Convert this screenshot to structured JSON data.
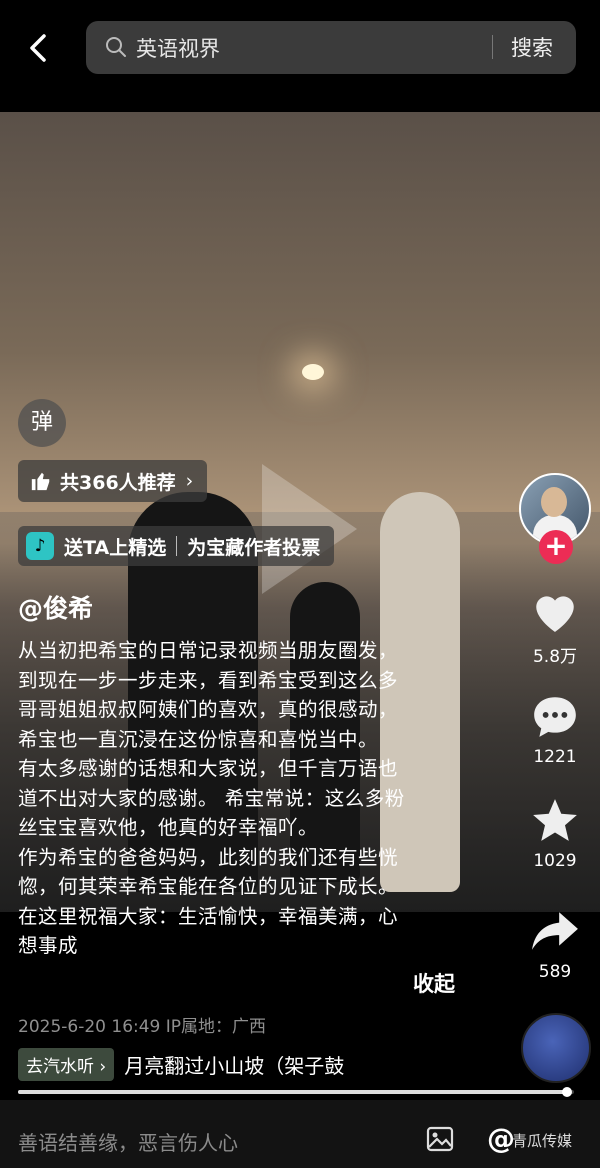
{
  "search": {
    "query": "英语视界",
    "button": "搜索"
  },
  "danmu": "弹",
  "recommend": {
    "label": "共366人推荐",
    "chevron": "›"
  },
  "featured": {
    "left": "送TA上精选",
    "right": "为宝藏作者投票",
    "logo": "♪"
  },
  "author": "@俊希",
  "description": [
    "从当初把希宝的日常记录视频当朋友圈发，",
    "到现在一步一步走来，看到希宝受到这么多",
    "哥哥姐姐叔叔阿姨们的喜欢，真的很感动，",
    "希宝也一直沉浸在这份惊喜和喜悦当中。",
    "有太多感谢的话想和大家说，但千言万语也",
    "道不出对大家的感谢。 希宝常说：这么多粉",
    "丝宝宝喜欢他，他真的好幸福吖。",
    "作为希宝的爸爸妈妈，此刻的我们还有些恍",
    "惚，何其荣幸希宝能在各位的见证下成长。",
    "在这里祝福大家：生活愉快，幸福美满，心",
    "想事成"
  ],
  "collapse": "收起",
  "meta": "2025-6-20 16:49  IP属地：广西",
  "music": {
    "tag": "去汽水听",
    "chevron": "›",
    "title": "月亮翻过小山坡（架子鼓"
  },
  "progress": 0.988,
  "actions": {
    "likes": "5.8万",
    "comments": "1221",
    "favorites": "1029",
    "shares": "589",
    "follow": "+"
  },
  "comment_placeholder": "善语结善缘，恶言伤人心",
  "at": "@",
  "watermark": "青瓜传媒",
  "colors": {
    "follow": "#ec2c55",
    "featured_logo": "#2ec4c4"
  }
}
